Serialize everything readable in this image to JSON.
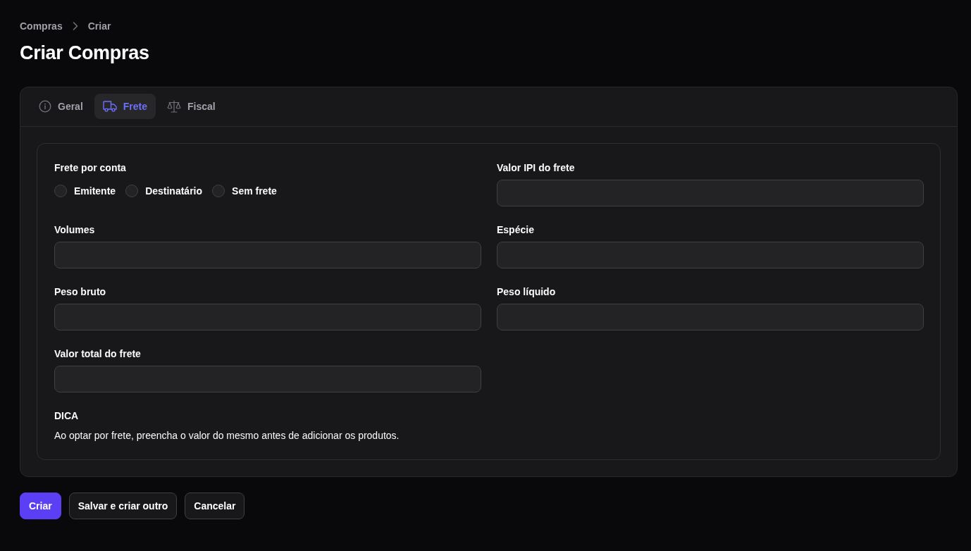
{
  "breadcrumbs": [
    "Compras",
    "Criar"
  ],
  "title": "Criar Compras",
  "tabs": [
    {
      "label": "Geral",
      "selected": false
    },
    {
      "label": "Frete",
      "selected": true
    },
    {
      "label": "Fiscal",
      "selected": false
    }
  ],
  "fields": [
    {
      "kind": "radio",
      "label": "Frete por conta",
      "options": [
        {
          "label": "Emitente",
          "selected": false
        },
        {
          "label": "Destinatário",
          "selected": false
        },
        {
          "label": "Sem frete",
          "selected": false
        }
      ]
    },
    {
      "kind": "input",
      "label": "Valor IPI do frete"
    },
    {
      "kind": "input",
      "label": "Volumes"
    },
    {
      "kind": "input",
      "label": "Espécie"
    },
    {
      "kind": "input",
      "label": "Peso bruto"
    },
    {
      "kind": "input",
      "label": "Peso líquido"
    },
    {
      "kind": "input",
      "label": "Valor total do frete"
    }
  ],
  "tip": {
    "title": "DICA",
    "text": "Ao optar por frete, preencha o valor do mesmo antes de adicionar os produtos."
  },
  "buttons": [
    {
      "label": "Criar",
      "kind": "primary"
    },
    {
      "label": "Salvar e criar outro",
      "kind": "secondary"
    },
    {
      "label": "Cancelar",
      "kind": "secondary"
    }
  ]
}
